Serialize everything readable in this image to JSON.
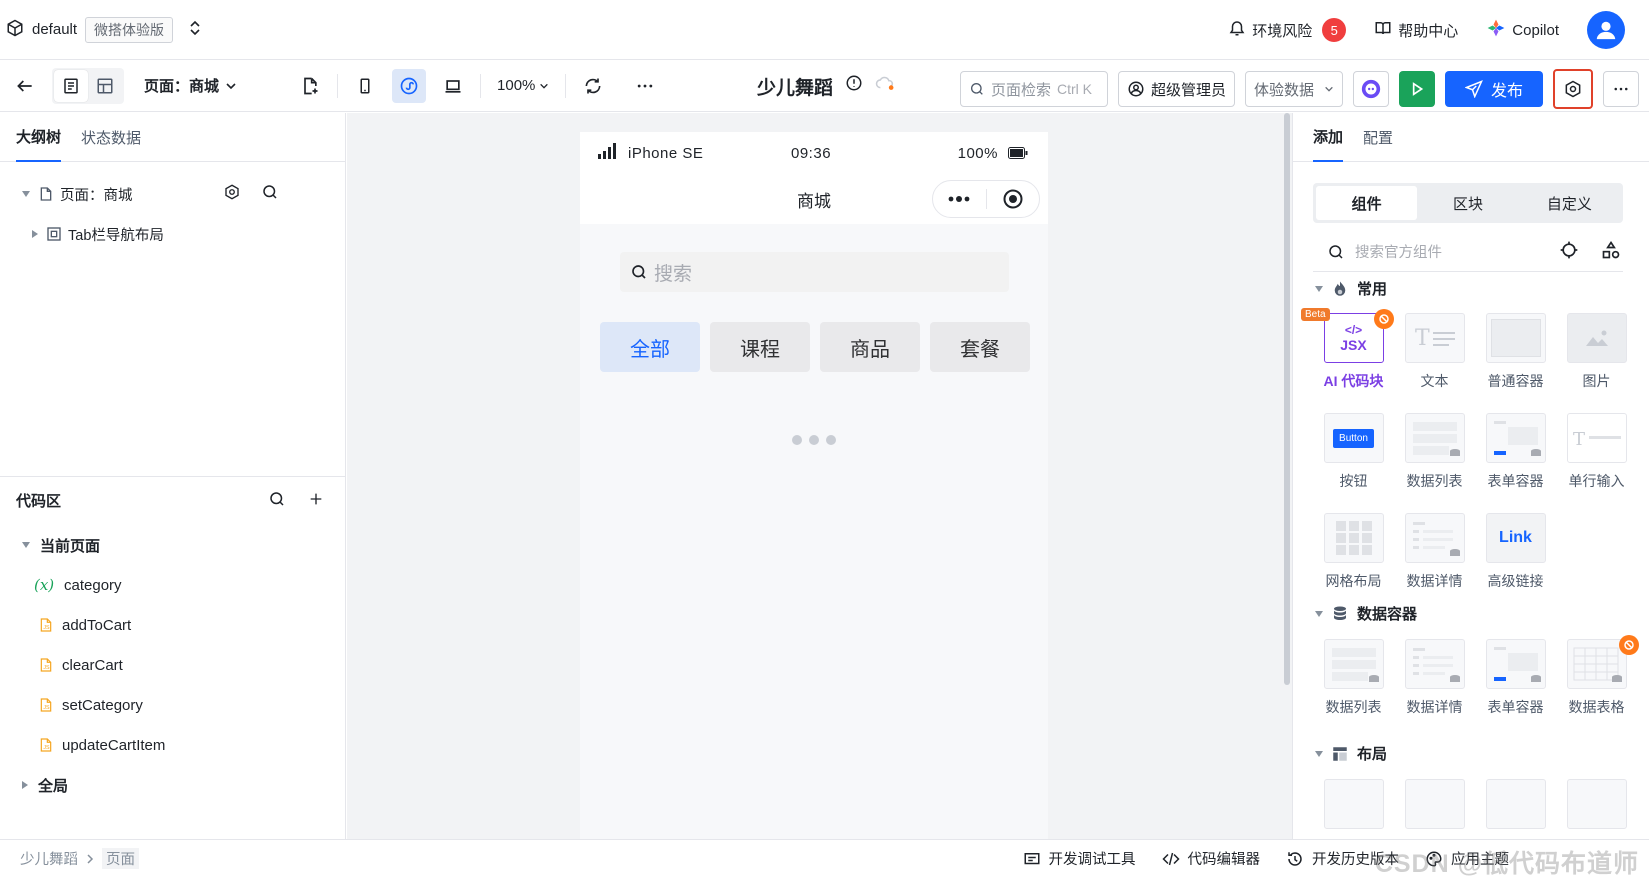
{
  "topbar": {
    "app_name": "default",
    "edition_tag": "微搭体验版",
    "env_risk_label": "环境风险",
    "env_risk_count": "5",
    "help_label": "帮助中心",
    "copilot_label": "Copilot"
  },
  "toolbar": {
    "page_selector": "页面：商城",
    "zoom": "100%",
    "page_title": "少儿舞蹈",
    "page_search_placeholder": "页面检索",
    "page_search_shortcut": "Ctrl K",
    "role": "超级管理员",
    "data_mode": "体验数据",
    "publish_label": "发布"
  },
  "left_panel": {
    "tabs": [
      "大纲树",
      "状态数据"
    ],
    "tree": {
      "page_node": "页面：商城",
      "child_node": "Tab栏导航布局"
    },
    "code_area": {
      "title": "代码区",
      "current_page_label": "当前页面",
      "items": [
        "category",
        "addToCart",
        "clearCart",
        "setCategory",
        "updateCartItem"
      ],
      "global_label": "全局"
    }
  },
  "phone": {
    "device": "iPhone SE",
    "time": "09:36",
    "battery": "100%",
    "nav_title": "商城",
    "search_placeholder": "搜索",
    "categories": [
      "全部",
      "课程",
      "商品",
      "套餐"
    ]
  },
  "right_panel": {
    "tabs": [
      "添加",
      "配置"
    ],
    "segments": [
      "组件",
      "区块",
      "自定义"
    ],
    "search_placeholder": "搜索官方组件",
    "section_common": "常用",
    "common_items": [
      "AI 代码块",
      "文本",
      "普通容器",
      "图片",
      "按钮",
      "数据列表",
      "表单容器",
      "单行输入",
      "网格布局",
      "数据详情",
      "高级链接"
    ],
    "beta_label": "Beta",
    "jsx_label": "JSX",
    "button_thumb_label": "Button",
    "link_thumb_label": "Link",
    "section_data": "数据容器",
    "data_items": [
      "数据列表",
      "数据详情",
      "表单容器",
      "数据表格"
    ],
    "section_layout": "布局"
  },
  "bottombar": {
    "breadcrumb": [
      "少儿舞蹈",
      "页面"
    ],
    "dev_tools": "开发调试工具",
    "code_editor": "代码编辑器",
    "history": "开发历史版本",
    "theme": "应用主题",
    "watermark": "CSDN @低代码布道师"
  },
  "colors": {
    "accent": "#1664ff",
    "run_green": "#1aa35a",
    "badge_red": "#f03e3e",
    "ai_purple": "#7b3fe4",
    "highlight_border": "#e0412a"
  }
}
